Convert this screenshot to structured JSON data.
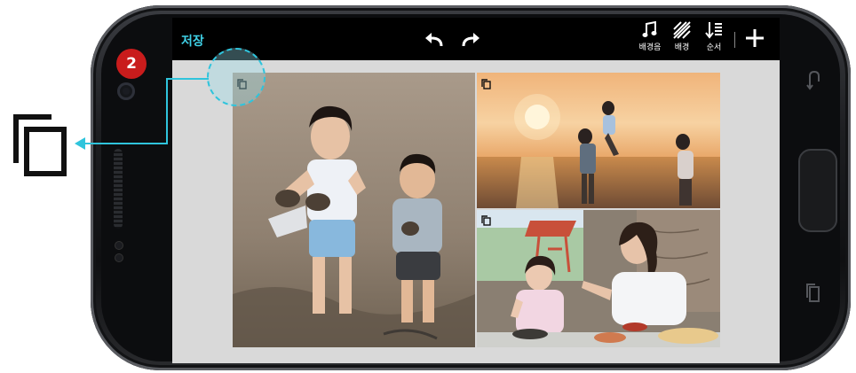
{
  "toolbar": {
    "save_label": "저장",
    "undo_icon": "undo-arrow-icon",
    "redo_icon": "redo-arrow-icon",
    "tools": [
      {
        "icon": "music-note-icon",
        "label": "배경음"
      },
      {
        "icon": "background-pattern-icon",
        "label": "배경"
      },
      {
        "icon": "sort-order-icon",
        "label": "순서"
      }
    ],
    "add_icon": "plus-icon"
  },
  "collage": {
    "photos": [
      {
        "name": "photo-kids-beach",
        "copy_icon": "copy-icon"
      },
      {
        "name": "photo-sunset-family",
        "copy_icon": "copy-icon"
      },
      {
        "name": "photo-mother-daughter-dining",
        "copy_icon": "copy-icon"
      }
    ]
  },
  "annotation": {
    "step_number": "2",
    "callout_icon": "copy-icon",
    "accent_color": "#2fc4dc",
    "badge_color": "#c91c1c"
  },
  "device": {
    "hardware_keys": [
      "back-key-icon",
      "home-button",
      "recent-apps-icon"
    ]
  }
}
